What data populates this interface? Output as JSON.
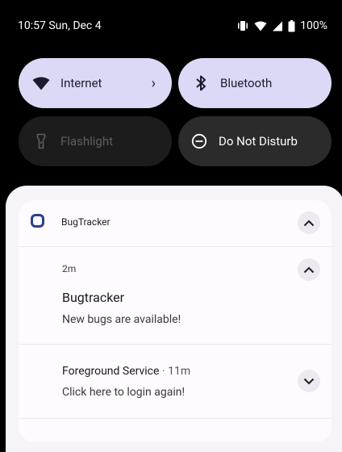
{
  "status_bar": {
    "time_date": "10:57 Sun, Dec 4",
    "battery": "100%",
    "icons": [
      "vibrate-icon",
      "wifi-icon",
      "signal-icon",
      "battery-icon"
    ]
  },
  "quick_settings": {
    "tiles": [
      {
        "label": "Internet",
        "icon": "wifi-icon",
        "state": "active",
        "chevron": "›"
      },
      {
        "label": "Bluetooth",
        "icon": "bluetooth-icon",
        "state": "active"
      },
      {
        "label": "Flashlight",
        "icon": "flashlight-icon",
        "state": "disabled"
      },
      {
        "label": "Do Not Disturb",
        "icon": "do-not-disturb-icon",
        "state": "inactive"
      }
    ]
  },
  "notification_group": {
    "app_name": "BugTracker",
    "notifications": [
      {
        "time": "2m",
        "title": "Bugtracker",
        "text": "New bugs are available!"
      },
      {
        "title": "Foreground Service",
        "separator": "·",
        "time": "11m",
        "text": "Click here to login again!"
      }
    ]
  },
  "colors": {
    "active_tile": "#dbd9f6",
    "inactive_tile": "#2b2b2b",
    "shade_background": "#f7f4f9",
    "app_icon": "#2b3f8a"
  }
}
